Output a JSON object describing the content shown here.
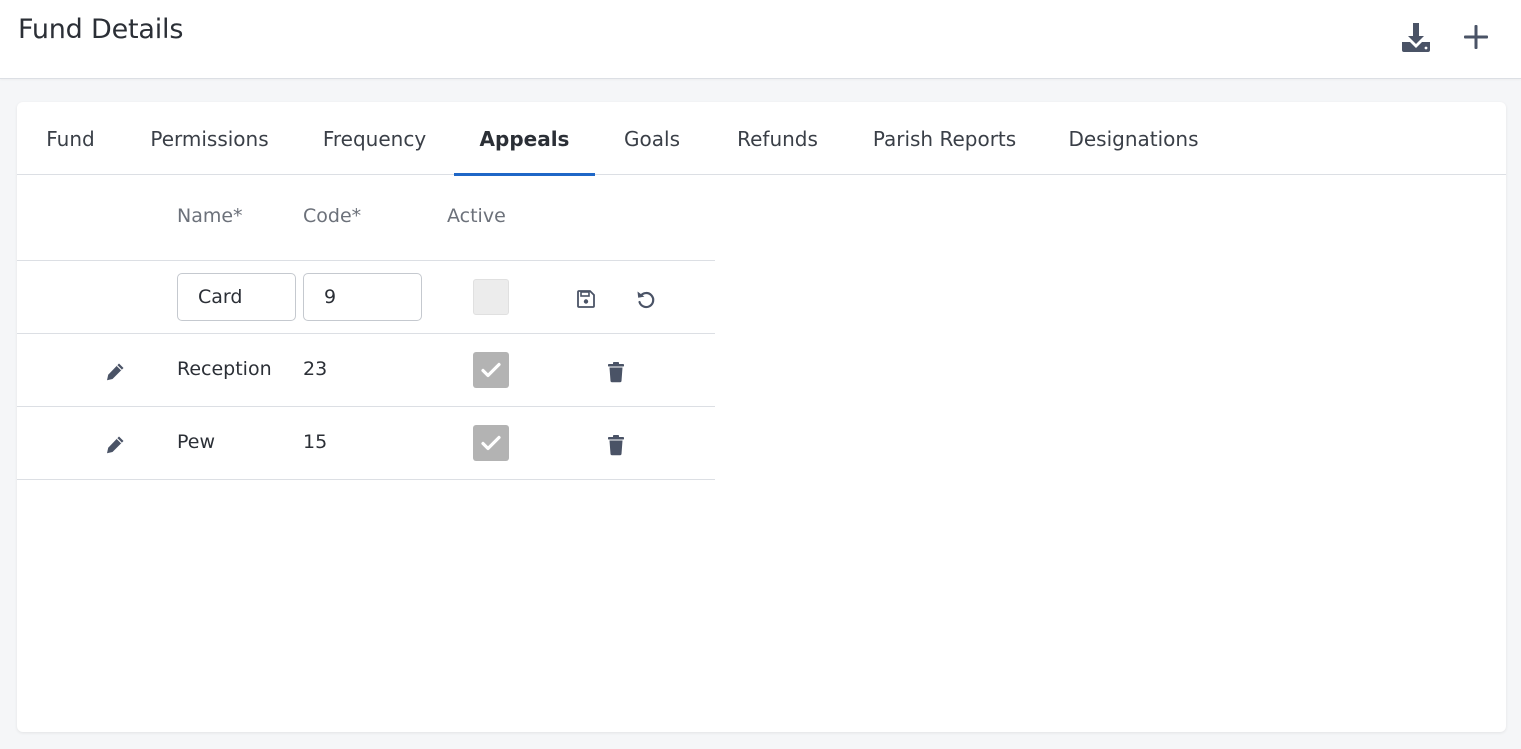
{
  "header": {
    "title": "Fund Details",
    "download_icon": "download-icon",
    "add_icon": "plus-icon"
  },
  "tabs": [
    {
      "label": "Fund",
      "active": false
    },
    {
      "label": "Permissions",
      "active": false
    },
    {
      "label": "Frequency",
      "active": false
    },
    {
      "label": "Appeals",
      "active": true
    },
    {
      "label": "Goals",
      "active": false
    },
    {
      "label": "Refunds",
      "active": false
    },
    {
      "label": "Parish Reports",
      "active": false
    },
    {
      "label": "Designations",
      "active": false
    }
  ],
  "table": {
    "columns": {
      "name": "Name*",
      "code": "Code*",
      "active": "Active"
    },
    "edit_row": {
      "name": "Card",
      "code": "9",
      "active": false
    },
    "rows": [
      {
        "name": "Reception",
        "code": "23",
        "active": true
      },
      {
        "name": "Pew",
        "code": "15",
        "active": true
      }
    ]
  },
  "colors": {
    "accent": "#1f67c7",
    "icon": "#4a5366",
    "checkbox_checked": "#b3b3b3"
  }
}
